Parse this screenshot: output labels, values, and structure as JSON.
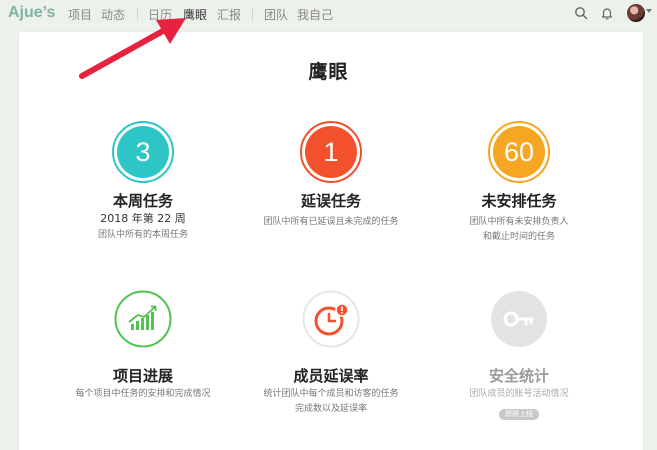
{
  "nav": {
    "brand": "Ajue’s",
    "items": [
      "项目",
      "动态",
      "日历",
      "鹰眼",
      "汇报",
      "团队",
      "我自己"
    ],
    "active_index": 3
  },
  "page": {
    "title": "鹰眼"
  },
  "tiles": [
    {
      "number": "3",
      "title": "本周任务",
      "subtitle": "2018 年第 22 周",
      "desc": "团队中所有的本周任务",
      "color": "#2dc5c5"
    },
    {
      "number": "1",
      "title": "延误任务",
      "desc": "团队中所有已延误且未完成的任务",
      "color": "#f2512b"
    },
    {
      "number": "60",
      "title": "未安排任务",
      "desc_line1": "团队中所有未安排负责人",
      "desc_line2": "和截止时间的任务",
      "color": "#f5a623"
    },
    {
      "icon": "chart-up-icon",
      "title": "项目进展",
      "desc": "每个项目中任务的安排和完成情况",
      "color": "#4fc24f"
    },
    {
      "icon": "clock-alert-icon",
      "title": "成员延误率",
      "desc_line1": "统计团队中每个成员和访客的任务",
      "desc_line2": "完成数以及延误率",
      "color": "#f2512b"
    },
    {
      "icon": "key-icon",
      "title": "安全统计",
      "desc": "团队成员的账号活动情况",
      "badge": "即将上线",
      "color": "#d4d4d4"
    }
  ]
}
